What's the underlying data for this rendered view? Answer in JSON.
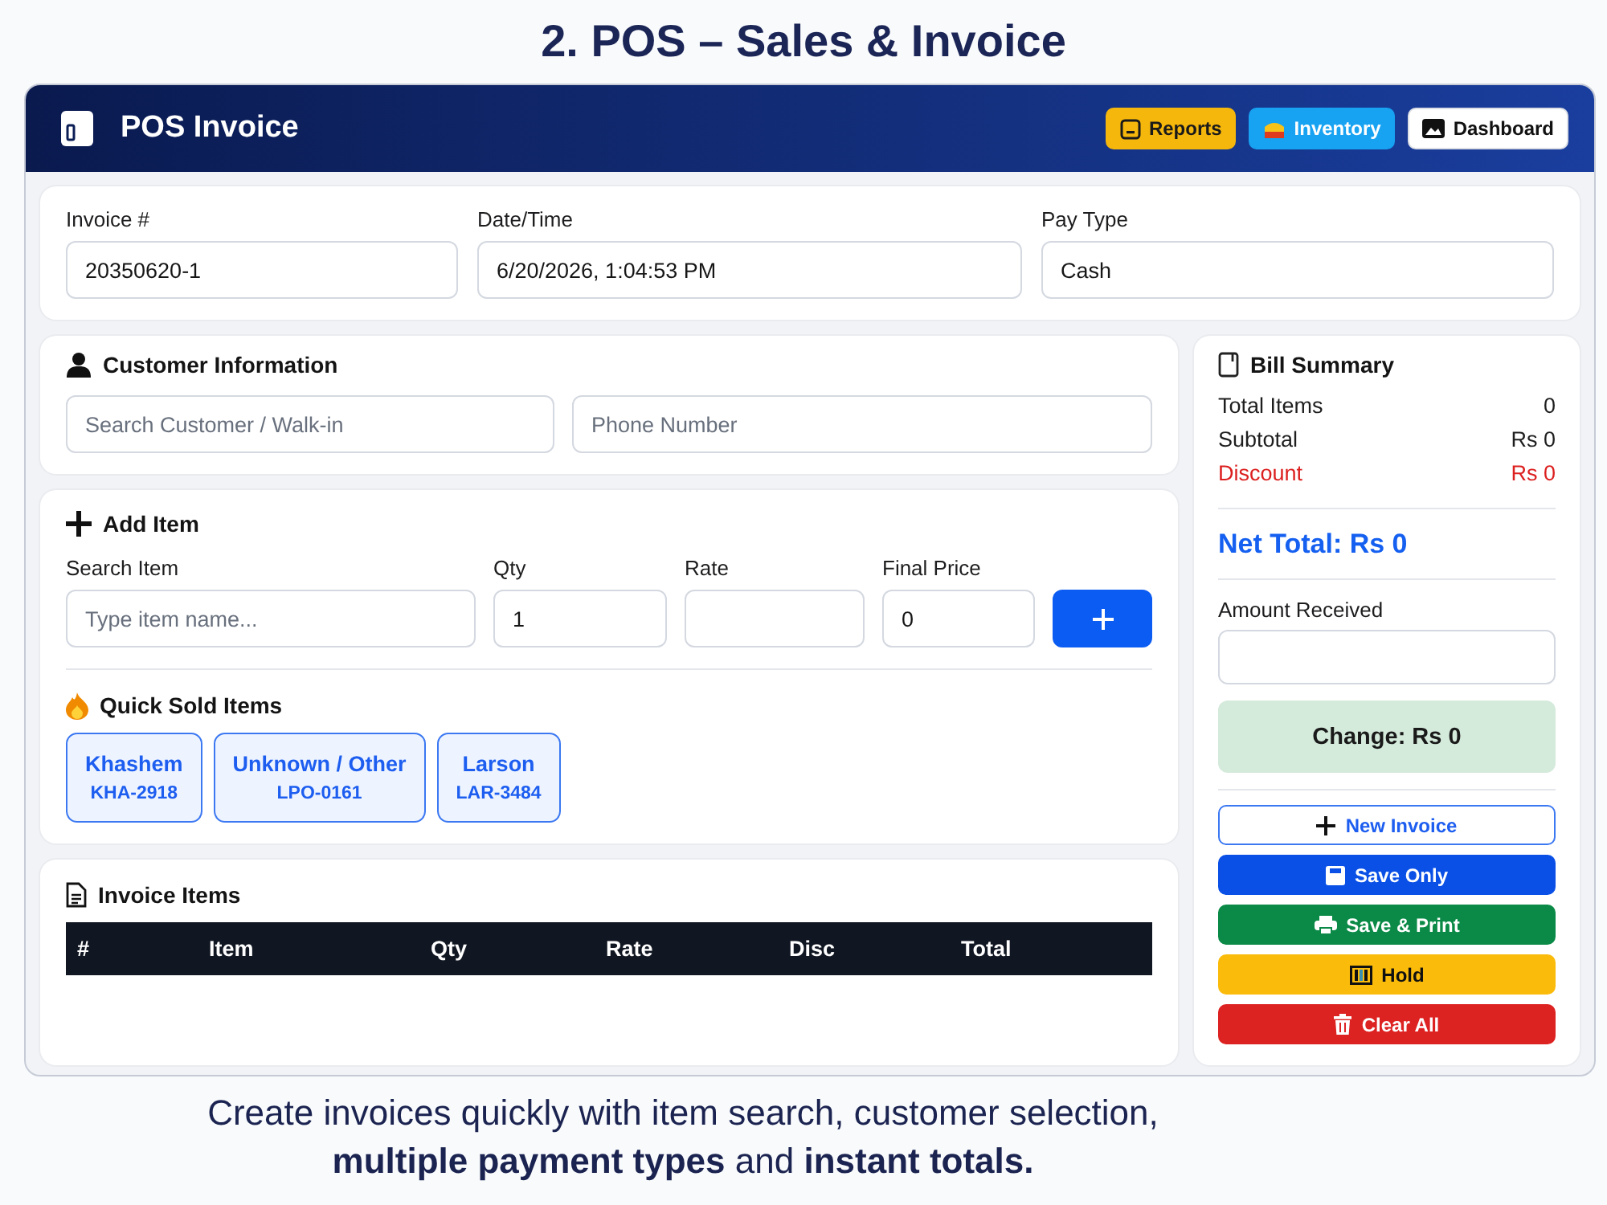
{
  "page_title": "2. POS – Sales & Invoice",
  "window": {
    "title": "POS Invoice",
    "nav_buttons": [
      {
        "label": "Reports",
        "kind": "reports"
      },
      {
        "label": "Inventory",
        "kind": "inventory"
      },
      {
        "label": "Dashboard",
        "kind": "dashboard"
      }
    ]
  },
  "invoice_fields": [
    {
      "label": "Invoice #",
      "value": "20350620-1"
    },
    {
      "label": "Date/Time",
      "value": "6/20/2026, 1:04:53 PM"
    },
    {
      "label": "Pay Type",
      "value": "Cash"
    }
  ],
  "customer": {
    "title": "Customer Information",
    "fields": [
      {
        "placeholder": "Search Customer / Walk-in"
      },
      {
        "placeholder": "Phone Number"
      }
    ]
  },
  "add_item": {
    "title": "Add Item",
    "fields": [
      {
        "label": "Search Item",
        "placeholder": "Type item name..."
      },
      {
        "label": "Qty",
        "value": "1"
      },
      {
        "label": "Rate"
      },
      {
        "label": "Final Price",
        "value": "0"
      }
    ]
  },
  "quick_sold": {
    "title": "Quick Sold Items",
    "items": [
      {
        "name": "Khashem",
        "code": "KHA-2918"
      },
      {
        "name": "Unknown / Other",
        "code": "LPO-0161"
      },
      {
        "name": "Larson",
        "code": "LAR-3484"
      }
    ]
  },
  "invoice_items": {
    "title": "Invoice Items",
    "table": {
      "columns": [
        "#",
        "Item",
        "Qty",
        "Rate",
        "Disc",
        "Total"
      ]
    }
  },
  "bill_summary": {
    "title": "Bill Summary",
    "rows": [
      {
        "label": "Total Items",
        "value": "0",
        "kind": "normal"
      },
      {
        "label": "Subtotal",
        "value": "Rs 0",
        "kind": "normal"
      },
      {
        "label": "Discount",
        "value": "Rs 0",
        "kind": "discount"
      }
    ],
    "net_total": "Net Total: Rs 0",
    "amount_received": {
      "label": "Amount Received"
    },
    "change": "Change: Rs 0",
    "actions": [
      {
        "label": "New Invoice",
        "kind": "new"
      },
      {
        "label": "Save Only",
        "kind": "save"
      },
      {
        "label": "Save & Print",
        "kind": "print"
      },
      {
        "label": "Hold",
        "kind": "hold"
      },
      {
        "label": "Clear All",
        "kind": "clear"
      }
    ]
  },
  "caption": "Create invoices quickly with item search, customer selection, **multiple payment types** and **instant totals.**"
}
